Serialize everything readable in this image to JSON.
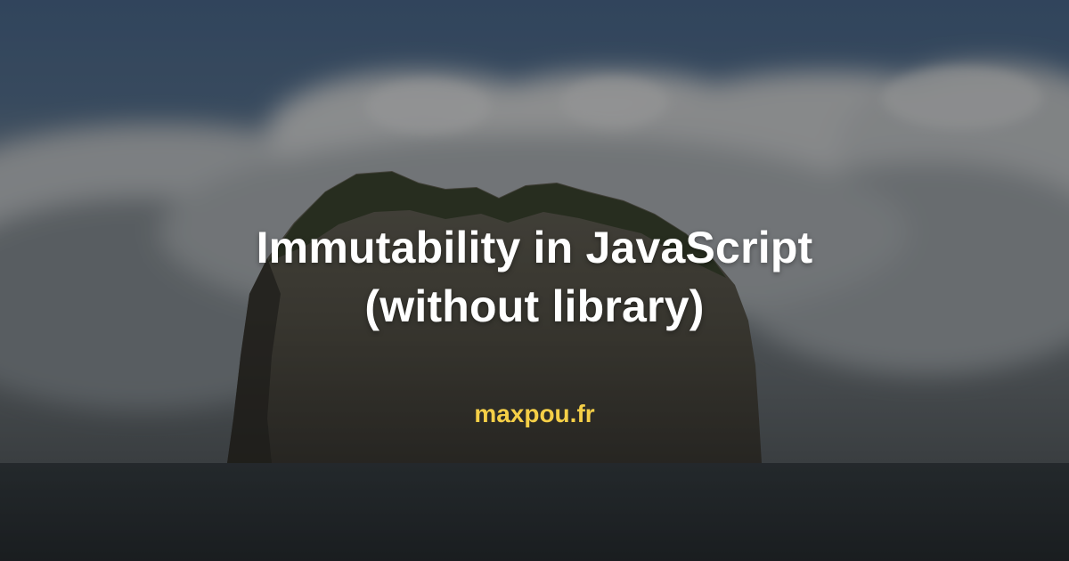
{
  "title": {
    "line1": "Immutability in JavaScript",
    "line2": "(without library)"
  },
  "site": {
    "label": "maxpou.fr",
    "color": "#f5cf47"
  },
  "colors": {
    "title": "#ffffff",
    "overlay": "rgba(0,0,0,0.38)"
  }
}
